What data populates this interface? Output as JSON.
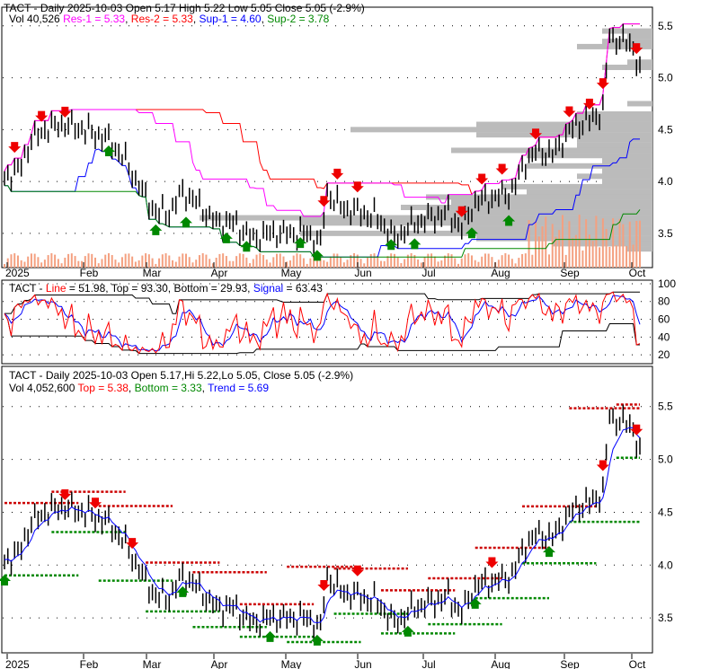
{
  "chart_data": [
    {
      "type": "line",
      "title": "TACT - Daily 2025-10-03 Open 5.17  High 5.22  Low 5.05  Close 5.05 (-2.9%)",
      "legend": {
        "vol": "Vol 40,526",
        "res1": "Res-1 = 5.33",
        "res2": "Res-2 = 5.33",
        "sup1": "Sup-1 = 4.60",
        "sup2": "Sup-2 = 3.78"
      },
      "ylim": [
        3.2,
        5.6
      ],
      "yticks": [
        "5.5",
        "5.0",
        "4.5",
        "4.0",
        "3.5"
      ],
      "xticks": [
        "2025",
        "Feb",
        "Mar",
        "Apr",
        "May",
        "Jun",
        "Jul",
        "Aug",
        "Sep",
        "Oct"
      ],
      "close_anchors": [
        [
          0,
          4.05
        ],
        [
          4,
          4.1
        ],
        [
          8,
          4.4
        ],
        [
          12,
          4.5
        ],
        [
          17,
          4.55
        ],
        [
          24,
          4.5
        ],
        [
          31,
          4.4
        ],
        [
          36,
          4.2
        ],
        [
          41,
          3.9
        ],
        [
          45,
          3.7
        ],
        [
          49,
          3.7
        ],
        [
          53,
          3.9
        ],
        [
          57,
          3.8
        ],
        [
          63,
          3.6
        ],
        [
          68,
          3.6
        ],
        [
          74,
          3.45
        ],
        [
          79,
          3.5
        ],
        [
          84,
          3.5
        ],
        [
          90,
          3.5
        ],
        [
          94,
          3.4
        ],
        [
          96,
          3.9
        ],
        [
          100,
          3.75
        ],
        [
          106,
          3.7
        ],
        [
          111,
          3.65
        ],
        [
          116,
          3.45
        ],
        [
          122,
          3.6
        ],
        [
          127,
          3.65
        ],
        [
          132,
          3.7
        ],
        [
          136,
          3.55
        ],
        [
          140,
          3.8
        ],
        [
          146,
          3.85
        ],
        [
          151,
          3.9
        ],
        [
          155,
          4.2
        ],
        [
          159,
          4.3
        ],
        [
          163,
          4.25
        ],
        [
          166,
          4.4
        ],
        [
          170,
          4.55
        ],
        [
          175,
          4.6
        ],
        [
          178,
          4.7
        ],
        [
          180,
          5.4
        ],
        [
          184,
          5.35
        ],
        [
          187,
          5.3
        ],
        [
          189,
          5.05
        ]
      ],
      "sell_arrows": [
        3,
        11,
        18,
        95,
        99,
        105,
        136,
        142,
        148,
        158,
        168,
        174,
        178,
        188
      ],
      "buy_arrows": [
        31,
        45,
        54,
        66,
        72,
        88,
        93,
        115,
        122,
        139,
        150
      ]
    },
    {
      "type": "line",
      "title": "TACT - Line = 51.98, Top = 93.30, Bottom = 29.93, Signal = 63.43",
      "legend": {
        "prefix": "TACT - ",
        "line": "Line",
        "line_val": " = 51.98, Top = 93.30, Bottom = 29.93, ",
        "signal": "Signal",
        "signal_val": " = 63.43"
      },
      "ylim": [
        10,
        100
      ],
      "yticks": [
        "100",
        "80",
        "60",
        "40",
        "20"
      ]
    },
    {
      "type": "line",
      "title": "TACT - Daily 2025-10-03 Open 5.17,Hi 5.22,Lo 5.05, Close 5.05 (-2.9%)",
      "legend": {
        "vol": "Vol 4,052,600",
        "top": "Top = 5.38",
        "bottom": "Bottom = 3.33",
        "trend": "Trend = 5.69"
      },
      "ylim": [
        3.2,
        5.85
      ],
      "yticks": [
        "5.5",
        "5.0",
        "4.5",
        "4.0",
        "3.5"
      ],
      "xticks": [
        "2025",
        "Feb",
        "Mar",
        "Apr",
        "May",
        "Jun",
        "Jul",
        "Aug",
        "Sep",
        "Oct"
      ]
    }
  ]
}
